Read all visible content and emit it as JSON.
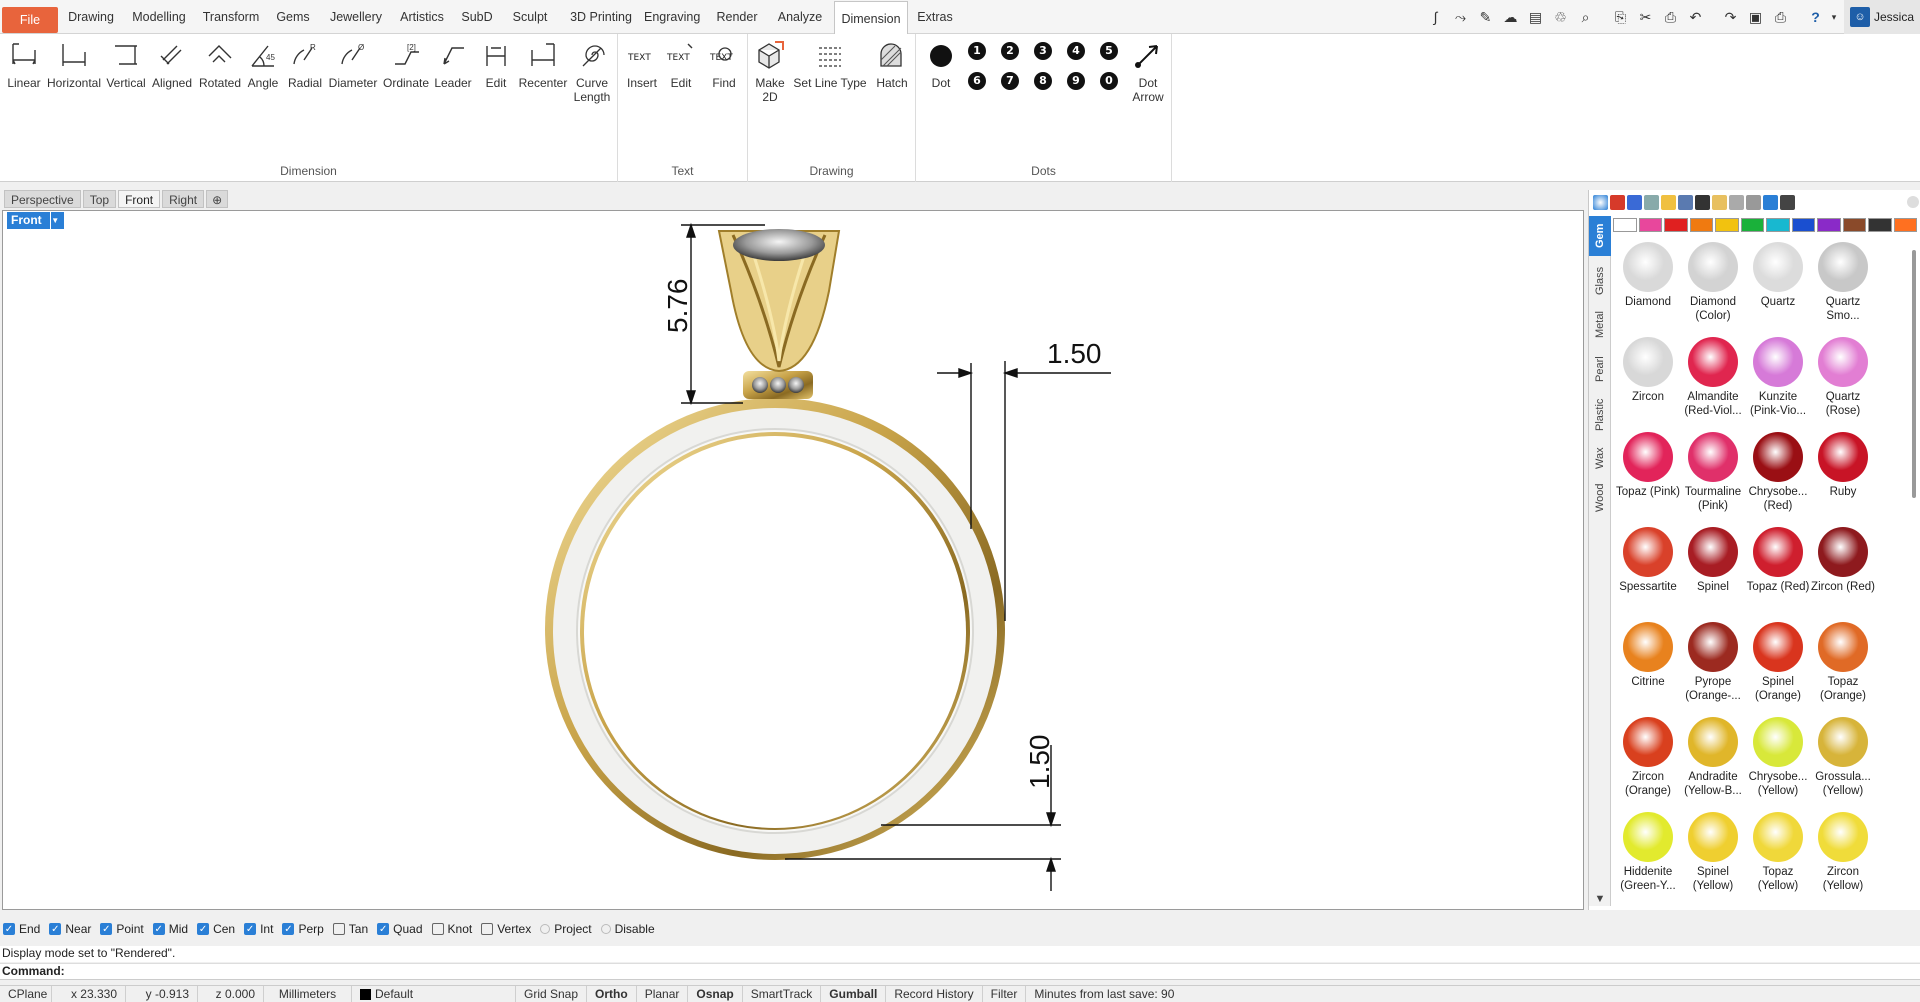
{
  "menubar": {
    "file": "File",
    "tabs": [
      "Drawing",
      "Modelling",
      "Transform",
      "Gems",
      "Jewellery",
      "Artistics",
      "SubD",
      "Sculpt",
      "3D Printing",
      "Engraving",
      "Render",
      "Analyze",
      "Dimension",
      "Extras"
    ],
    "active_tab": "Dimension",
    "user": "Jessica"
  },
  "ribbon": {
    "groups": {
      "dimension": "Dimension",
      "text": "Text",
      "drawing": "Drawing",
      "dots": "Dots"
    },
    "dimension_tools": [
      "Linear",
      "Horizontal",
      "Vertical",
      "Aligned",
      "Rotated",
      "Angle",
      "Radial",
      "Diameter",
      "Ordinate",
      "Leader",
      "Edit",
      "Recenter",
      "Curve Length"
    ],
    "text_tools": [
      "Insert",
      "Edit",
      "Find"
    ],
    "text_icon": "TEXT",
    "drawing_tools": [
      "Make 2D",
      "Set Line Type",
      "Hatch"
    ],
    "dots_tools": [
      "Dot",
      "Dot Arrow"
    ],
    "dot_numbers": [
      "1",
      "2",
      "3",
      "4",
      "5",
      "6",
      "7",
      "8",
      "9",
      "0"
    ]
  },
  "viewport_tabs": [
    "Perspective",
    "Top",
    "Front",
    "Right"
  ],
  "active_viewport": "Front",
  "viewport": {
    "label": "Front",
    "dimensions": {
      "height": "5.76",
      "width": "1.50",
      "thickness": "1.50"
    }
  },
  "panel": {
    "side_tabs": [
      "Gem",
      "Glass",
      "Metal",
      "Pearl",
      "Plastic",
      "Wax",
      "Wood"
    ],
    "swatches": [
      "#ffffff",
      "#e8479c",
      "#e02020",
      "#f07a10",
      "#f2c20f",
      "#1ab13a",
      "#18b8d0",
      "#1a4fd0",
      "#8a2ac8",
      "#8a4a2a",
      "#333333",
      "#ff7020"
    ],
    "gems": [
      {
        "name": "Diamond",
        "color": "#d9d9d9"
      },
      {
        "name": "Diamond (Color)",
        "color": "#d3d3d3"
      },
      {
        "name": "Quartz",
        "color": "#dcdcdc"
      },
      {
        "name": "Quartz Smo...",
        "color": "#c8c8c8"
      },
      {
        "name": "Zircon",
        "color": "#d8d8d8"
      },
      {
        "name": "Almandite (Red-Viol...",
        "color": "#e0264f"
      },
      {
        "name": "Kunzite (Pink-Vio...",
        "color": "#d67ad8"
      },
      {
        "name": "Quartz (Rose)",
        "color": "#e27ed3"
      },
      {
        "name": "Topaz (Pink)",
        "color": "#e2245a"
      },
      {
        "name": "Tourmaline (Pink)",
        "color": "#e0306a"
      },
      {
        "name": "Chrysobe... (Red)",
        "color": "#9a0f14"
      },
      {
        "name": "Ruby",
        "color": "#c81426"
      },
      {
        "name": "Spessartite",
        "color": "#d9412a"
      },
      {
        "name": "Spinel",
        "color": "#a81d24"
      },
      {
        "name": "Topaz (Red)",
        "color": "#cf1f2e"
      },
      {
        "name": "Zircon (Red)",
        "color": "#8e1a1e"
      },
      {
        "name": "Citrine",
        "color": "#e8821e"
      },
      {
        "name": "Pyrope (Orange-...",
        "color": "#9c2a20"
      },
      {
        "name": "Spinel (Orange)",
        "color": "#d9351e"
      },
      {
        "name": "Topaz (Orange)",
        "color": "#e06a26"
      },
      {
        "name": "Zircon (Orange)",
        "color": "#d9401e"
      },
      {
        "name": "Andradite (Yellow-B...",
        "color": "#e0b62a"
      },
      {
        "name": "Chrysobe... (Yellow)",
        "color": "#d8e83a"
      },
      {
        "name": "Grossula... (Yellow)",
        "color": "#d7b43a"
      },
      {
        "name": "Hiddenite (Green-Y...",
        "color": "#e2ea2e"
      },
      {
        "name": "Spinel (Yellow)",
        "color": "#efcf30"
      },
      {
        "name": "Topaz (Yellow)",
        "color": "#f0d83a"
      },
      {
        "name": "Zircon (Yellow)",
        "color": "#f0dc3a"
      }
    ]
  },
  "osnap": [
    {
      "label": "End",
      "checked": true
    },
    {
      "label": "Near",
      "checked": true
    },
    {
      "label": "Point",
      "checked": true
    },
    {
      "label": "Mid",
      "checked": true
    },
    {
      "label": "Cen",
      "checked": true
    },
    {
      "label": "Int",
      "checked": true
    },
    {
      "label": "Perp",
      "checked": true
    },
    {
      "label": "Tan",
      "checked": false
    },
    {
      "label": "Quad",
      "checked": true
    },
    {
      "label": "Knot",
      "checked": false
    },
    {
      "label": "Vertex",
      "checked": false
    },
    {
      "label": "Project",
      "checked": false,
      "disabled": true
    },
    {
      "label": "Disable",
      "checked": false,
      "disabled": true
    }
  ],
  "history_line": "Display mode set to \"Rendered\".",
  "command_label": "Command:",
  "status": {
    "cplane": "CPlane",
    "x": "x 23.330",
    "y": "y -0.913",
    "z": "z 0.000",
    "units": "Millimeters",
    "layer": "Default",
    "toggles": [
      "Grid Snap",
      "Ortho",
      "Planar",
      "Osnap",
      "SmartTrack",
      "Gumball",
      "Record History",
      "Filter"
    ],
    "bold_toggles": [
      "Ortho",
      "Osnap",
      "Gumball"
    ],
    "save_info": "Minutes from last save: 90"
  }
}
